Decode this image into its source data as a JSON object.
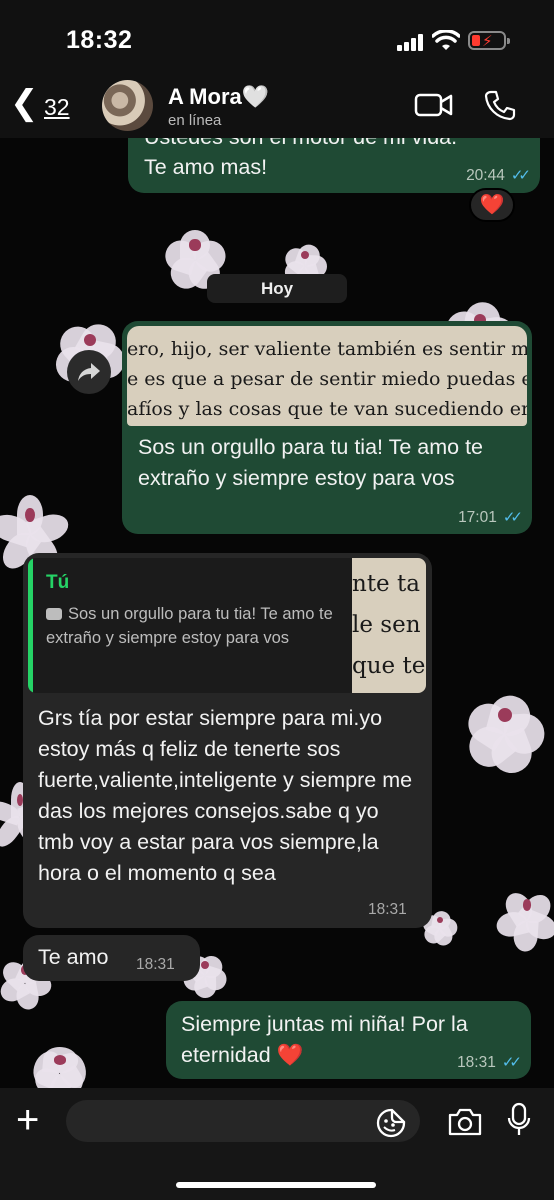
{
  "status_bar": {
    "time": "18:32"
  },
  "header": {
    "back_count": "32",
    "contact_name": "A Mora🤍",
    "contact_status": "en línea"
  },
  "messages": {
    "m1": {
      "text_top": "Ustedes son el motor de mi vida.",
      "text": "Te amo mas!",
      "time": "20:44",
      "reaction": "❤️"
    },
    "date_separator": "Hoy",
    "m2": {
      "photo_lines": [
        "ero, hijo, ser valiente también es sentir mie",
        "e es que a pesar de sentir miedo puedas en",
        "afíos y las cosas que te van sucediendo en"
      ],
      "caption": "Sos un orgullo para tu tia! Te amo te extraño y siempre estoy para vos",
      "time": "17:01"
    },
    "m3": {
      "quote_author": "Tú",
      "quote_text": "Sos un orgullo para tu tia! Te amo te extraño y siempre estoy para vos",
      "quote_thumb_lines": [
        "nte ta",
        "le sen",
        "que te"
      ],
      "text": "Grs tía por estar siempre para mi.yo estoy más q feliz de tenerte sos fuerte,valiente,inteligente y siempre me das los mejores consejos.sabe q yo tmb voy a estar para vos siempre,la hora o el momento q sea",
      "time": "18:31"
    },
    "m4": {
      "text": "Te amo",
      "time": "18:31"
    },
    "m5": {
      "text": "Siempre juntas mi niña! Por la eternidad",
      "heart": "❤️",
      "time": "18:31"
    }
  },
  "input": {
    "placeholder": ""
  },
  "colors": {
    "outgoing_bubble": "#1f4a34",
    "incoming_bubble": "#262626",
    "accent": "#25d366",
    "read_ticks": "#53bdeb"
  }
}
